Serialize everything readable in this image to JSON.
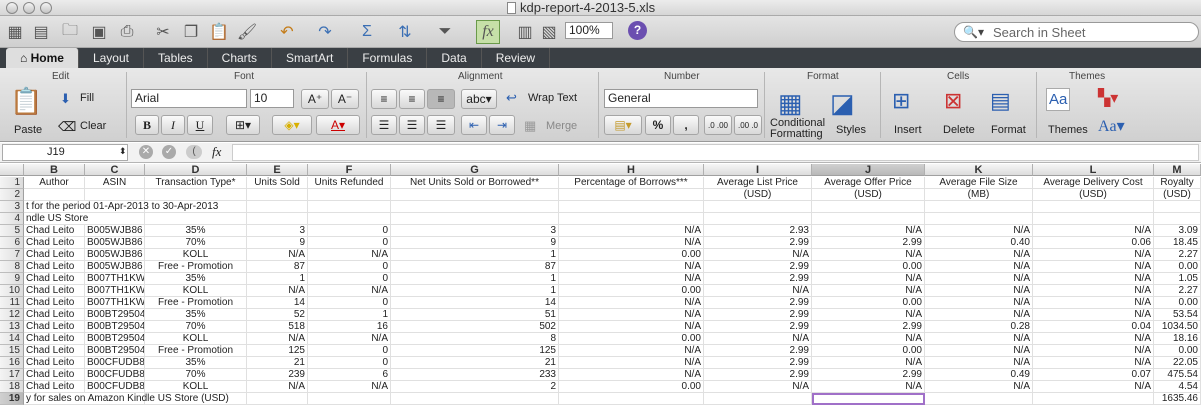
{
  "window": {
    "title": "kdp-report-4-2013-5.xls"
  },
  "toolbar": {
    "zoom": "100%",
    "help_label": "?",
    "search_placeholder": "Search in Sheet"
  },
  "ribbon_tabs": [
    "Home",
    "Layout",
    "Tables",
    "Charts",
    "SmartArt",
    "Formulas",
    "Data",
    "Review"
  ],
  "ribbon": {
    "groups": {
      "edit": "Edit",
      "font": "Font",
      "alignment": "Alignment",
      "number": "Number",
      "format": "Format",
      "cells": "Cells",
      "themes": "Themes"
    },
    "paste": "Paste",
    "fill": "Fill",
    "clear": "Clear",
    "font_name": "Arial",
    "font_size": "10",
    "bold": "B",
    "italic": "I",
    "underline": "U",
    "wrap_text": "Wrap Text",
    "merge": "Merge",
    "wrap_abc": "abc",
    "number_format": "General",
    "percent": "%",
    "comma": ",",
    "dec_inc": ".0 .00",
    "dec_dec": ".00 .0",
    "conditional_formatting": "Conditional Formatting",
    "styles": "Styles",
    "insert": "Insert",
    "delete": "Delete",
    "format": "Format",
    "themes": "Themes",
    "themes_aa": "Aa"
  },
  "formula_bar": {
    "name_box": "J19",
    "fx": "fx",
    "content": ""
  },
  "sheet": {
    "columns": [
      "B",
      "C",
      "D",
      "E",
      "F",
      "G",
      "H",
      "I",
      "J",
      "K",
      "L",
      "M"
    ],
    "rows": [
      [
        "Author",
        "ASIN",
        "Transaction Type*",
        "Units Sold",
        "Units Refunded",
        "Net Units Sold or Borrowed**",
        "Percentage of Borrows***",
        "Average List Price",
        "Average Offer Price",
        "Average File Size",
        "Average Delivery Cost",
        "Royalty"
      ],
      [
        "",
        "",
        "",
        "",
        "",
        "",
        "",
        "(USD)",
        "(USD)",
        "(MB)",
        "(USD)",
        "(USD)"
      ],
      [
        "t for the period 01-Apr-2013 to 30-Apr-2013",
        "",
        "",
        "",
        "",
        "",
        "",
        "",
        "",
        "",
        "",
        ""
      ],
      [
        "ndle US Store",
        "",
        "",
        "",
        "",
        "",
        "",
        "",
        "",
        "",
        "",
        ""
      ],
      [
        "Chad Leito",
        "B005WJB86",
        "35%",
        "3",
        "0",
        "3",
        "N/A",
        "2.93",
        "N/A",
        "N/A",
        "N/A",
        "3.09"
      ],
      [
        "Chad Leito",
        "B005WJB86",
        "70%",
        "9",
        "0",
        "9",
        "N/A",
        "2.99",
        "2.99",
        "0.40",
        "0.06",
        "18.45"
      ],
      [
        "Chad Leito",
        "B005WJB86",
        "KOLL",
        "N/A",
        "N/A",
        "1",
        "0.00",
        "N/A",
        "N/A",
        "N/A",
        "N/A",
        "2.27"
      ],
      [
        "Chad Leito",
        "B005WJB86",
        "Free - Promotion",
        "87",
        "0",
        "87",
        "N/A",
        "2.99",
        "0.00",
        "N/A",
        "N/A",
        "0.00"
      ],
      [
        "Chad Leito",
        "B007TH1KW",
        "35%",
        "1",
        "0",
        "1",
        "N/A",
        "2.99",
        "N/A",
        "N/A",
        "N/A",
        "1.05"
      ],
      [
        "Chad Leito",
        "B007TH1KW",
        "KOLL",
        "N/A",
        "N/A",
        "1",
        "0.00",
        "N/A",
        "N/A",
        "N/A",
        "N/A",
        "2.27"
      ],
      [
        "Chad Leito",
        "B007TH1KW",
        "Free - Promotion",
        "14",
        "0",
        "14",
        "N/A",
        "2.99",
        "0.00",
        "N/A",
        "N/A",
        "0.00"
      ],
      [
        "Chad Leito",
        "B00BT29504",
        "35%",
        "52",
        "1",
        "51",
        "N/A",
        "2.99",
        "N/A",
        "N/A",
        "N/A",
        "53.54"
      ],
      [
        "Chad Leito",
        "B00BT29504",
        "70%",
        "518",
        "16",
        "502",
        "N/A",
        "2.99",
        "2.99",
        "0.28",
        "0.04",
        "1034.50"
      ],
      [
        "Chad Leito",
        "B00BT29504",
        "KOLL",
        "N/A",
        "N/A",
        "8",
        "0.00",
        "N/A",
        "N/A",
        "N/A",
        "N/A",
        "18.16"
      ],
      [
        "Chad Leito",
        "B00BT29504",
        "Free - Promotion",
        "125",
        "0",
        "125",
        "N/A",
        "2.99",
        "0.00",
        "N/A",
        "N/A",
        "0.00"
      ],
      [
        "Chad Leito",
        "B00CFUDB8",
        "35%",
        "21",
        "0",
        "21",
        "N/A",
        "2.99",
        "N/A",
        "N/A",
        "N/A",
        "22.05"
      ],
      [
        "Chad Leito",
        "B00CFUDB8",
        "70%",
        "239",
        "6",
        "233",
        "N/A",
        "2.99",
        "2.99",
        "0.49",
        "0.07",
        "475.54"
      ],
      [
        "Chad Leito",
        "B00CFUDB8",
        "KOLL",
        "N/A",
        "N/A",
        "2",
        "0.00",
        "N/A",
        "N/A",
        "N/A",
        "N/A",
        "4.54"
      ],
      [
        "y for sales on Amazon Kindle US Store (USD)",
        "",
        "",
        "",
        "",
        "",
        "",
        "",
        "",
        "",
        "",
        "1635.46"
      ]
    ]
  }
}
